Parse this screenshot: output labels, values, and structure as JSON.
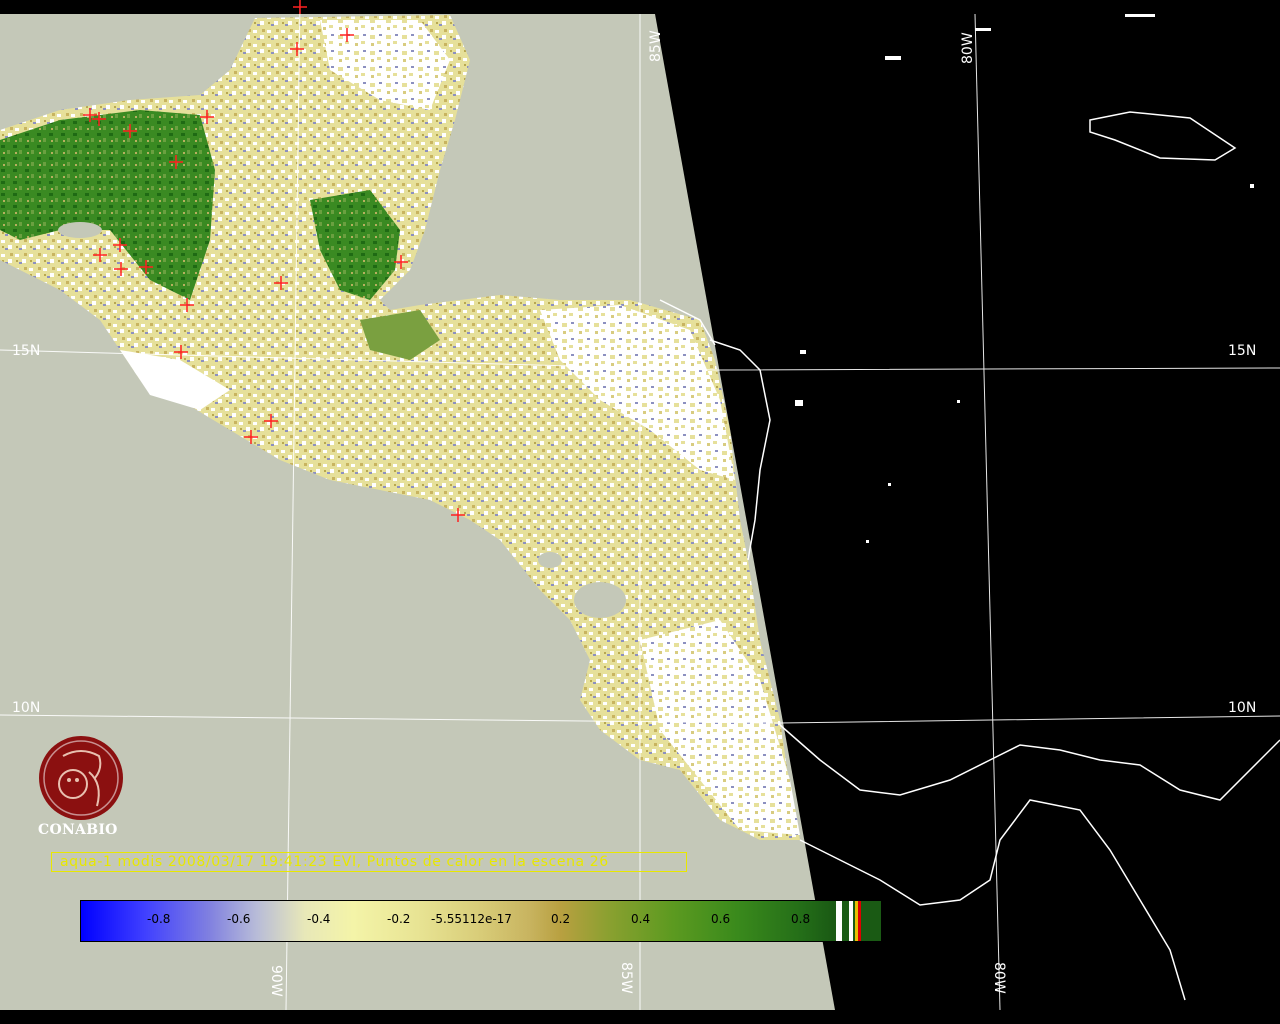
{
  "caption": "aqua-1 modis 2008/03/17 19:41:23 EVI, Puntos de calor en la escena 26",
  "logo": {
    "text": "CONABIO",
    "icon": "conabio-logo-icon",
    "color": "#8b1010"
  },
  "gridlabels": {
    "lat_15": "15N",
    "lat_10": "10N",
    "lon_85": "85W",
    "lon_80": "80W",
    "lon_90": "90W"
  },
  "colorbar": {
    "ticks": [
      "-0.8",
      "-0.6",
      "-0.4",
      "-0.2",
      "-5.55112e-17",
      "0.2",
      "0.4",
      "0.6",
      "0.8"
    ]
  },
  "colors": {
    "ocean": "#c4c8b8",
    "night": "#000000",
    "land_white": "#ffffff",
    "land_yellow": "#e6e09a",
    "land_green": "#2f7e1c",
    "fire_marker": "#ff2020",
    "caption": "#e8e800",
    "grid": "#ffffff"
  }
}
